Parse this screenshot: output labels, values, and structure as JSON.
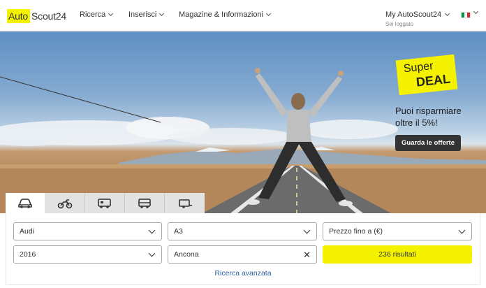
{
  "header": {
    "logo": {
      "part1": "Auto",
      "part2": "Scout24"
    },
    "nav": [
      {
        "label": "Ricerca"
      },
      {
        "label": "Inserisci"
      },
      {
        "label": "Magazine & Informazioni"
      }
    ],
    "account": {
      "label": "My AutoScout24",
      "status": "Sei loggato"
    },
    "language": {
      "flag_colors": [
        "#009246",
        "#ffffff",
        "#ce2b37"
      ]
    }
  },
  "promo": {
    "badge_line1": "Super",
    "badge_line2": "DEAL",
    "text_line1": "Puoi risparmiare",
    "text_line2": "oltre il 5%!",
    "button_label": "Guarda le offerte"
  },
  "vehicle_tabs": [
    {
      "icon": "car-icon",
      "active": true
    },
    {
      "icon": "motorbike-icon",
      "active": false
    },
    {
      "icon": "camper-icon",
      "active": false
    },
    {
      "icon": "truck-icon",
      "active": false
    },
    {
      "icon": "trailer-icon",
      "active": false
    }
  ],
  "search": {
    "make": "Audi",
    "model": "A3",
    "price": "Prezzo fino a (€)",
    "year": "2016",
    "location": "Ancona",
    "results_label": "236 risultati",
    "advanced_link": "Ricerca avanzata"
  },
  "colors": {
    "accent": "#f5f200",
    "dark_button": "#333333",
    "link": "#2b5f9e"
  }
}
